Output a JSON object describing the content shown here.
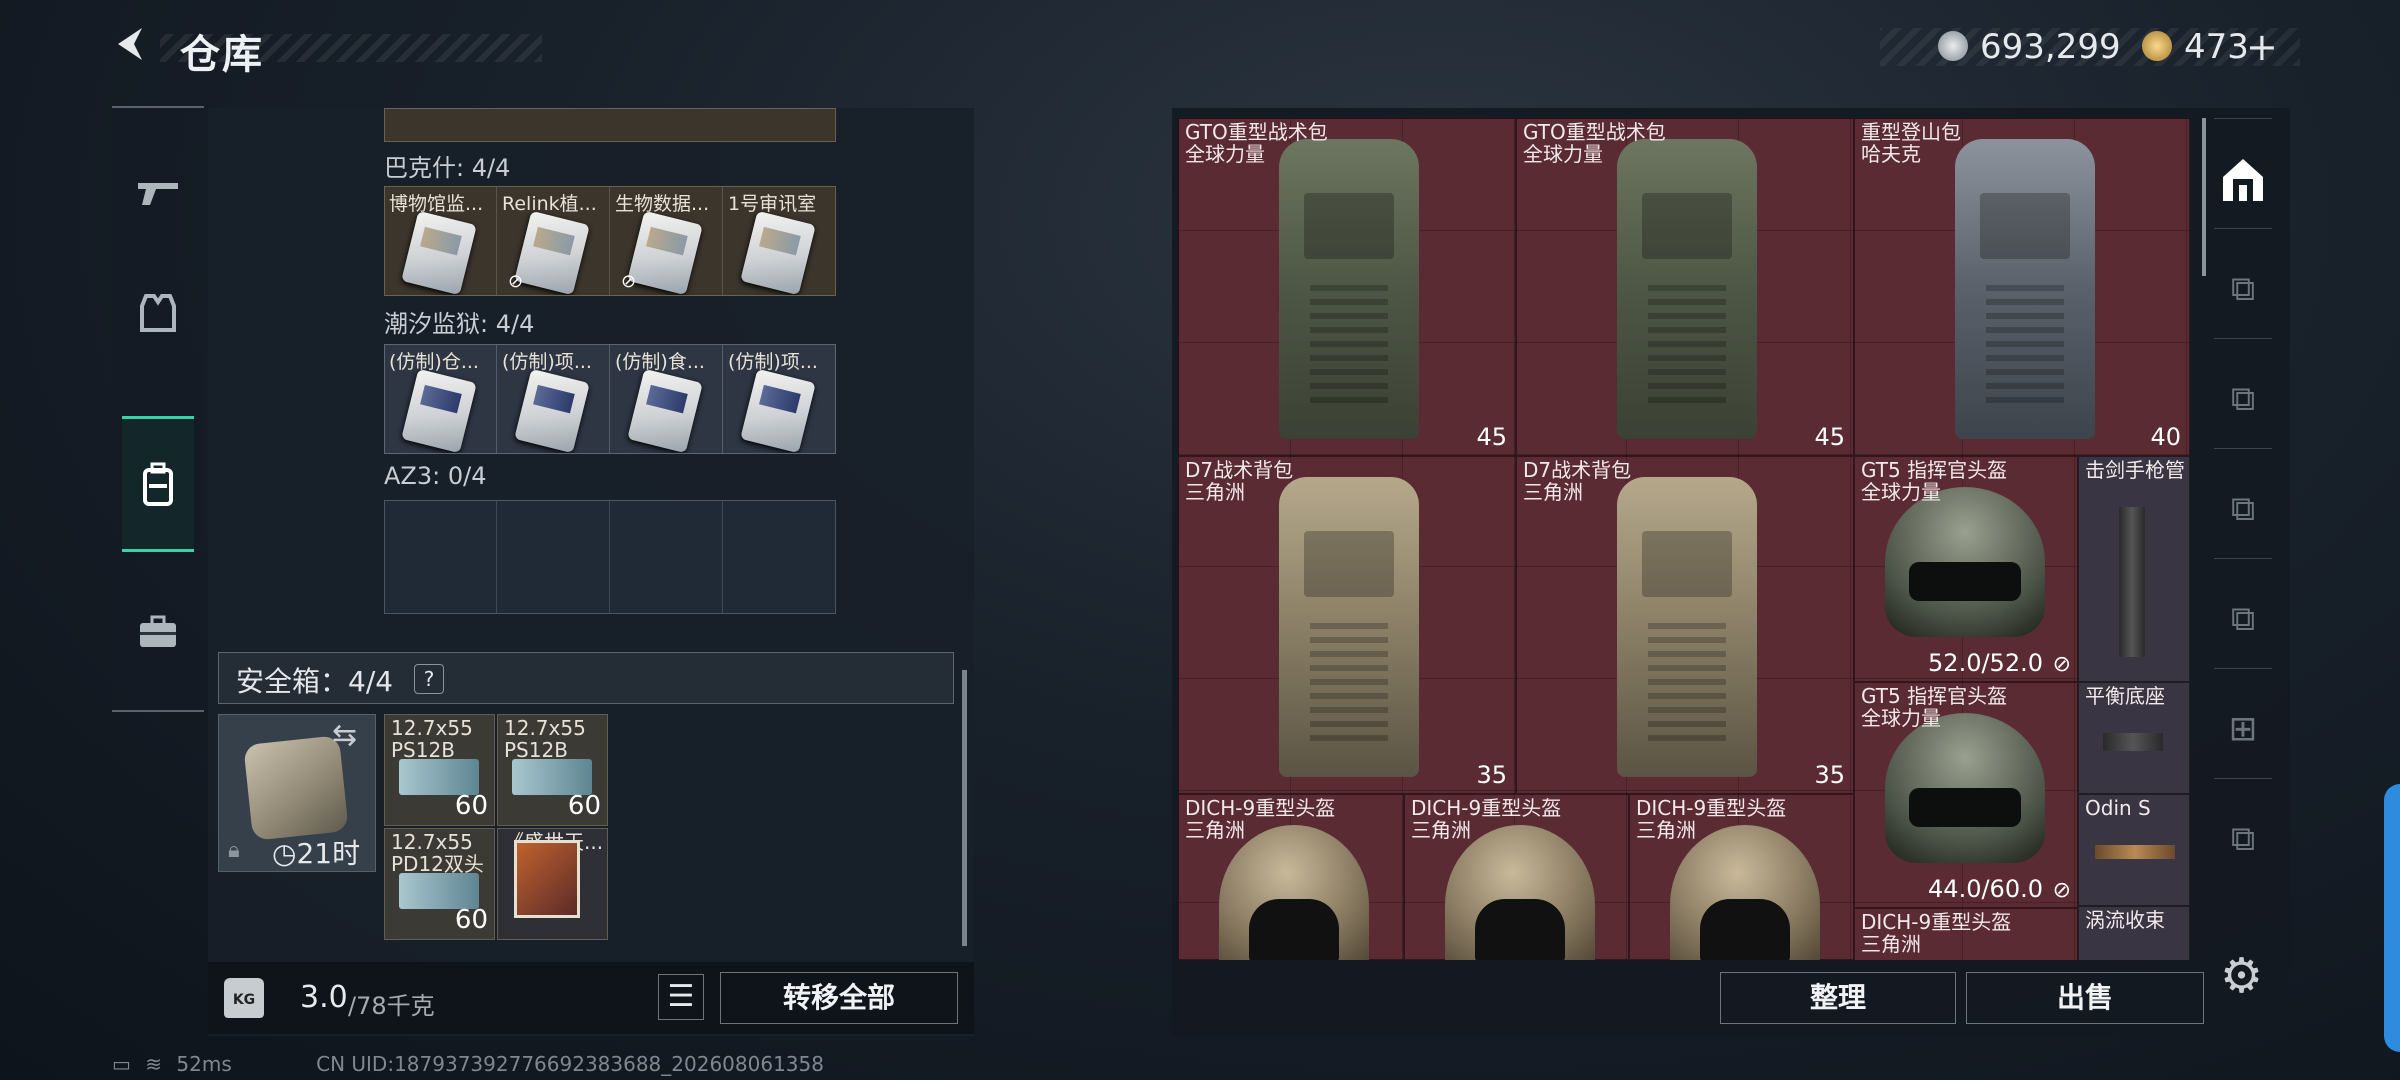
{
  "header": {
    "title": "仓库",
    "back_icon": "back-arrow-icon"
  },
  "currency": {
    "silver": "693,299",
    "gold": "473",
    "gold_add": "+"
  },
  "left_nav": [
    {
      "icon": "weapon-icon"
    },
    {
      "icon": "vest-icon"
    },
    {
      "icon": "backpack-icon"
    },
    {
      "icon": "briefcase-icon"
    }
  ],
  "key_sections": [
    {
      "label": "巴克什: 4/4",
      "cards": [
        {
          "name": "博物馆监..."
        },
        {
          "name": "Relink植..."
        },
        {
          "name": "生物数据..."
        },
        {
          "name": "1号审讯室"
        }
      ]
    },
    {
      "label": "潮汐监狱: 4/4",
      "cards": [
        {
          "name": "(仿制)仓..."
        },
        {
          "name": "(仿制)项..."
        },
        {
          "name": "(仿制)食..."
        },
        {
          "name": "(仿制)项..."
        }
      ]
    },
    {
      "label": "AZ3: 0/4",
      "cards": []
    }
  ],
  "safe_box": {
    "label": "安全箱：4/4",
    "help": "?",
    "time": "21时",
    "items": [
      {
        "name": "12.7x55\nPS12B",
        "count": "60"
      },
      {
        "name": "12.7x55\nPS12B",
        "count": "60"
      },
      {
        "name": "12.7x55\nPD12双头",
        "count": "60"
      },
      {
        "name": "《盛世天...",
        "count": ""
      }
    ]
  },
  "weight": {
    "current": "3.0",
    "max": "/78千克",
    "icon": "KG"
  },
  "buttons": {
    "transfer_all": "转移全部",
    "sort": "整理",
    "sell": "出售"
  },
  "status": {
    "ping": "52ms",
    "uid": "CN UID:187937392776692383688_202608061358"
  },
  "stash_items": [
    {
      "name": "GTO重型战术包\n全球力量",
      "value": "45"
    },
    {
      "name": "GTO重型战术包\n全球力量",
      "value": "45"
    },
    {
      "name": "重型登山包\n哈夫克",
      "value": "40"
    },
    {
      "name": "D7战术背包\n三角洲",
      "value": "35"
    },
    {
      "name": "D7战术背包\n三角洲",
      "value": "35"
    },
    {
      "name": "GT5 指挥官头盔\n全球力量",
      "value": "52.0/52.0"
    },
    {
      "name": "击剑手枪管",
      "value": ""
    },
    {
      "name": "GT5 指挥官头盔\n全球力量",
      "value": "44.0/60.0"
    },
    {
      "name": "平衡底座",
      "value": ""
    },
    {
      "name": "DICH-9重型头盔\n三角洲",
      "value": ""
    },
    {
      "name": "DICH-9重型头盔\n三角洲",
      "value": ""
    },
    {
      "name": "DICH-9重型头盔\n三角洲",
      "value": ""
    },
    {
      "name": "Odin S",
      "value": ""
    },
    {
      "name": "DICH-9重型头盔\n三角洲",
      "value": ""
    },
    {
      "name": "涡流收束",
      "value": ""
    }
  ],
  "colors": {
    "accent": "#35d3a6",
    "stash_bg": "#5a2b33",
    "edge_tab": "#2f8be0"
  }
}
